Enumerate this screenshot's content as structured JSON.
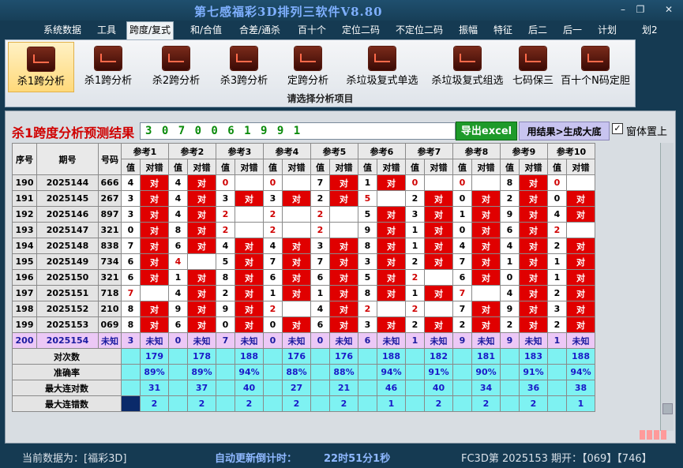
{
  "app_title": "第七感福彩3D排列三软件V8.80",
  "window_buttons": [
    "–",
    "❐",
    "✕"
  ],
  "menu": [
    "系统数据",
    "工具",
    "跨度/复式",
    "和/合值",
    "合差/通杀",
    "百十个",
    "定位二码",
    "不定位二码",
    "振幅",
    "特征",
    "后二",
    "后一",
    "计划",
    "划2"
  ],
  "ribbon": {
    "buttons": [
      "杀1跨分析",
      "杀1跨分析",
      "杀2跨分析",
      "杀3跨分析",
      "定跨分析",
      "杀垃圾复式单选",
      "杀垃圾复式组选",
      "七码保三",
      "百十个N码定胆"
    ],
    "caption": "请选择分析项目"
  },
  "result": {
    "title": "杀1跨度分析预测结果",
    "value": "3 0 7 0 0 6 1 9 9 1",
    "excel_button": "导出excel",
    "gen_button": "用结果>生成大底",
    "checkbox_label": "窗体置上",
    "checkbox_checked": true
  },
  "table": {
    "col_headers": [
      "序号",
      "期号",
      "号码"
    ],
    "ref_headers": [
      "参考1",
      "参考2",
      "参考3",
      "参考4",
      "参考5",
      "参考6",
      "参考7",
      "参考8",
      "参考9",
      "参考10"
    ],
    "sub_headers": [
      "值",
      "对错"
    ],
    "rows": [
      {
        "idx": "190",
        "period": "2025144",
        "num": "666",
        "vals": [
          "4",
          "4",
          "0",
          "0",
          "7",
          "1",
          "0",
          "0",
          "8",
          "0"
        ],
        "hits": [
          1,
          1,
          0,
          0,
          1,
          1,
          0,
          0,
          1,
          0
        ],
        "red": [
          0,
          0,
          1,
          1,
          0,
          0,
          1,
          1,
          0,
          1
        ]
      },
      {
        "idx": "191",
        "period": "2025145",
        "num": "267",
        "vals": [
          "3",
          "4",
          "3",
          "3",
          "2",
          "5",
          "2",
          "0",
          "2",
          "0"
        ],
        "hits": [
          1,
          1,
          1,
          1,
          1,
          0,
          1,
          1,
          1,
          1
        ],
        "red": [
          0,
          0,
          0,
          0,
          0,
          1,
          0,
          0,
          0,
          0
        ]
      },
      {
        "idx": "192",
        "period": "2025146",
        "num": "897",
        "vals": [
          "3",
          "4",
          "2",
          "2",
          "2",
          "5",
          "3",
          "1",
          "9",
          "4"
        ],
        "hits": [
          1,
          1,
          0,
          0,
          0,
          1,
          1,
          1,
          1,
          1
        ],
        "red": [
          0,
          0,
          1,
          1,
          1,
          0,
          0,
          0,
          0,
          0
        ]
      },
      {
        "idx": "193",
        "period": "2025147",
        "num": "321",
        "vals": [
          "0",
          "8",
          "2",
          "2",
          "2",
          "9",
          "1",
          "0",
          "6",
          "2"
        ],
        "hits": [
          1,
          1,
          0,
          0,
          0,
          1,
          1,
          1,
          1,
          0
        ],
        "red": [
          0,
          0,
          1,
          1,
          1,
          0,
          0,
          0,
          0,
          1
        ]
      },
      {
        "idx": "194",
        "period": "2025148",
        "num": "838",
        "vals": [
          "7",
          "6",
          "4",
          "4",
          "3",
          "8",
          "1",
          "4",
          "4",
          "2"
        ],
        "hits": [
          1,
          1,
          1,
          1,
          1,
          1,
          1,
          1,
          1,
          1
        ],
        "red": [
          0,
          0,
          0,
          0,
          0,
          0,
          0,
          0,
          0,
          0
        ]
      },
      {
        "idx": "195",
        "period": "2025149",
        "num": "734",
        "vals": [
          "6",
          "4",
          "5",
          "7",
          "7",
          "3",
          "2",
          "7",
          "1",
          "1"
        ],
        "hits": [
          1,
          0,
          1,
          1,
          1,
          1,
          1,
          1,
          1,
          1
        ],
        "red": [
          0,
          1,
          0,
          0,
          0,
          0,
          0,
          0,
          0,
          0
        ]
      },
      {
        "idx": "196",
        "period": "2025150",
        "num": "321",
        "vals": [
          "6",
          "1",
          "8",
          "6",
          "6",
          "5",
          "2",
          "6",
          "0",
          "1"
        ],
        "hits": [
          1,
          1,
          1,
          1,
          1,
          1,
          0,
          1,
          1,
          1
        ],
        "red": [
          0,
          0,
          0,
          0,
          0,
          0,
          1,
          0,
          0,
          0
        ]
      },
      {
        "idx": "197",
        "period": "2025151",
        "num": "718",
        "vals": [
          "7",
          "4",
          "2",
          "1",
          "1",
          "8",
          "1",
          "7",
          "4",
          "2"
        ],
        "hits": [
          0,
          1,
          1,
          1,
          1,
          1,
          1,
          0,
          1,
          1
        ],
        "red": [
          1,
          0,
          0,
          0,
          0,
          0,
          0,
          1,
          0,
          0
        ]
      },
      {
        "idx": "198",
        "period": "2025152",
        "num": "210",
        "vals": [
          "8",
          "9",
          "9",
          "2",
          "4",
          "2",
          "2",
          "7",
          "9",
          "3"
        ],
        "hits": [
          1,
          1,
          1,
          0,
          1,
          0,
          0,
          1,
          1,
          1
        ],
        "red": [
          0,
          0,
          0,
          1,
          0,
          1,
          1,
          0,
          0,
          0
        ]
      },
      {
        "idx": "199",
        "period": "2025153",
        "num": "069",
        "vals": [
          "8",
          "6",
          "0",
          "0",
          "6",
          "3",
          "2",
          "2",
          "2",
          "2"
        ],
        "hits": [
          1,
          1,
          1,
          1,
          1,
          1,
          1,
          1,
          1,
          1
        ],
        "red": [
          0,
          0,
          0,
          0,
          0,
          0,
          0,
          0,
          0,
          0
        ]
      }
    ],
    "unknown_row": {
      "idx": "200",
      "period": "2025154",
      "num": "未知",
      "vals": [
        "3",
        "0",
        "7",
        "0",
        "0",
        "6",
        "1",
        "9",
        "9",
        "1"
      ],
      "mark": "未知"
    },
    "stat_rows": [
      {
        "label": "对次数",
        "vals": [
          "179",
          "178",
          "188",
          "176",
          "176",
          "188",
          "182",
          "181",
          "183",
          "188"
        ]
      },
      {
        "label": "准确率",
        "vals": [
          "89%",
          "89%",
          "94%",
          "88%",
          "88%",
          "94%",
          "91%",
          "90%",
          "91%",
          "94%"
        ]
      },
      {
        "label": "最大连对数",
        "vals": [
          "31",
          "37",
          "40",
          "27",
          "21",
          "46",
          "40",
          "34",
          "36",
          "38"
        ]
      },
      {
        "label": "最大连错数",
        "vals": [
          "2",
          "2",
          "2",
          "2",
          "2",
          "1",
          "2",
          "2",
          "2",
          "1"
        ]
      }
    ],
    "hit_mark": "对"
  },
  "status": {
    "current_data": "当前数据为：[福彩3D]",
    "countdown_label": "自动更新倒计时：",
    "countdown_value": "22时51分1秒",
    "draw_info": "FC3D第 2025153 期开：【069】【746】"
  },
  "colors": {
    "hit": "#e00000",
    "accent_blue": "#7fb0ff",
    "stat_bg": "#7ef2f2",
    "unknown_bg": "#ecc8f6"
  }
}
